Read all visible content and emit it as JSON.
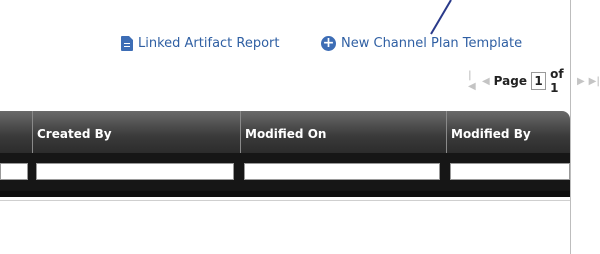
{
  "toolbar": {
    "linked_report_label": "Linked Artifact Report",
    "new_template_label": "New Channel Plan Template"
  },
  "pager": {
    "page_label": "Page",
    "current_page": "1",
    "of_label": "of 1"
  },
  "table": {
    "columns": [
      "Created By",
      "Modified On",
      "Modified By"
    ]
  },
  "colors": {
    "link": "#2f5fa3",
    "header_bg": "#3a3a3a",
    "annotation": "#2a3a8a"
  },
  "icons": [
    "document-icon",
    "plus-circle-icon",
    "first-page-icon",
    "previous-page-icon",
    "next-page-icon",
    "last-page-icon"
  ]
}
